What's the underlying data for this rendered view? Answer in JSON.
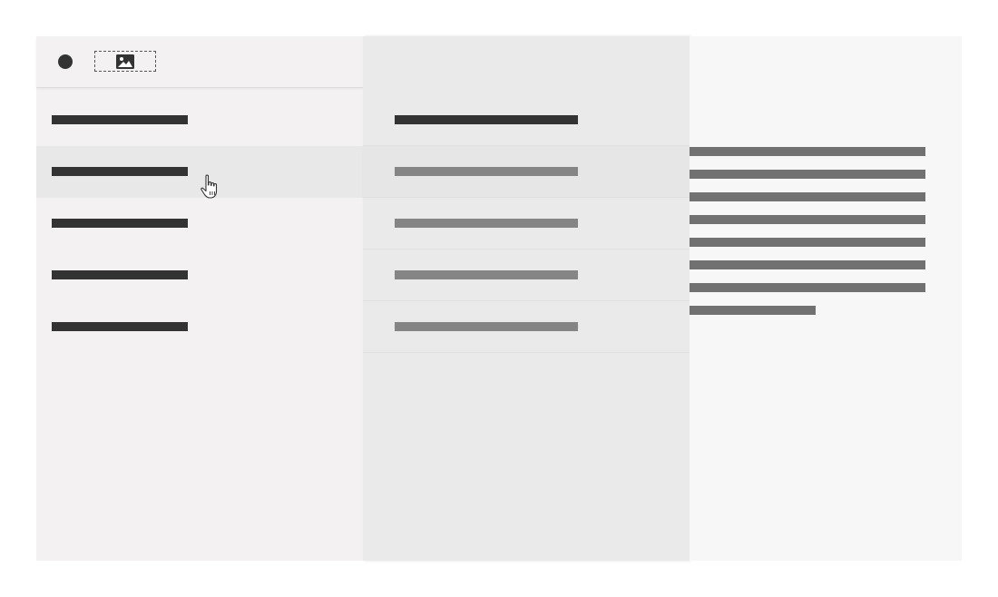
{
  "window": {
    "status_icon": "filled-circle-icon",
    "logo_icon": "image-placeholder-icon"
  },
  "nav": {
    "items": [
      {
        "id": "nav-item-1",
        "state": "default"
      },
      {
        "id": "nav-item-2",
        "state": "hovered"
      },
      {
        "id": "nav-item-3",
        "state": "default"
      },
      {
        "id": "nav-item-4",
        "state": "default"
      },
      {
        "id": "nav-item-5",
        "state": "default"
      }
    ]
  },
  "list": {
    "items": [
      {
        "id": "list-item-1",
        "style": "primary"
      },
      {
        "id": "list-item-2",
        "style": "secondary"
      },
      {
        "id": "list-item-3",
        "style": "secondary"
      },
      {
        "id": "list-item-4",
        "style": "secondary"
      },
      {
        "id": "list-item-5",
        "style": "secondary"
      }
    ]
  },
  "detail": {
    "line_count": 8
  },
  "colors": {
    "nav_bg": "#f3f1f2",
    "list_bg": "#eaeaea",
    "detail_bg": "#f7f7f7",
    "dark_text": "#333333",
    "muted_text": "#858585",
    "body_text": "#717171"
  },
  "cursor_icon": "pointer-hand-icon"
}
